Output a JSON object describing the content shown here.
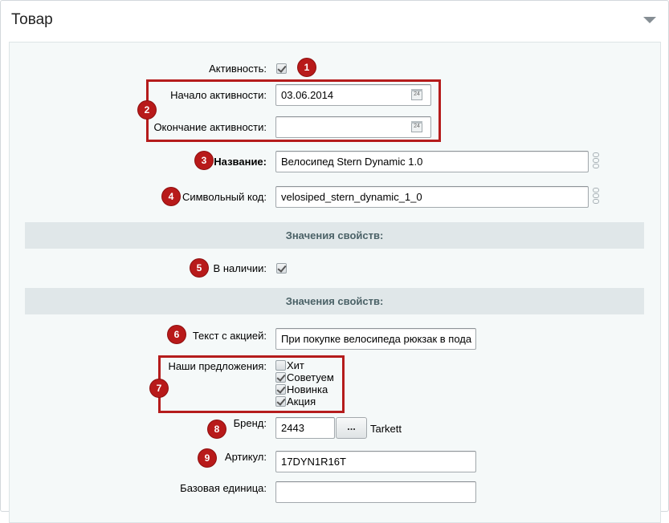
{
  "panel": {
    "title": "Товар",
    "collapse_icon": "chevron-down-icon"
  },
  "fields": {
    "active": {
      "label": "Активность:",
      "checked": true
    },
    "active_from": {
      "label": "Начало активности:",
      "value": "03.06.2014",
      "icon": "calendar-icon",
      "icon_text": "24"
    },
    "active_to": {
      "label": "Окончание активности:",
      "value": "",
      "icon": "calendar-icon",
      "icon_text": "24"
    },
    "name": {
      "label": "Название:",
      "value": "Велосипед Stern Dynamic 1.0",
      "icon": "link-icon"
    },
    "code": {
      "label": "Символьный код:",
      "value": "velosiped_stern_dynamic_1_0",
      "icon": "link-icon"
    },
    "in_stock": {
      "label": "В наличии:",
      "checked": true
    },
    "promo_text": {
      "label": "Текст с акцией:",
      "value": "При покупке велосипеда рюкзак в пода"
    },
    "offers": {
      "label": "Наши предложения:",
      "options": [
        {
          "label": "Хит",
          "checked": false
        },
        {
          "label": "Советуем",
          "checked": true
        },
        {
          "label": "Новинка",
          "checked": true
        },
        {
          "label": "Акция",
          "checked": true
        }
      ]
    },
    "brand": {
      "label": "Бренд:",
      "value": "2443",
      "button": "...",
      "brand_name": "Tarkett"
    },
    "article": {
      "label": "Артикул:",
      "value": "17DYN1R16T"
    },
    "base_unit": {
      "label": "Базовая единица:",
      "value": ""
    }
  },
  "sections": {
    "props1": "Значения свойств:",
    "props2": "Значения свойств:"
  },
  "badges": [
    "1",
    "2",
    "3",
    "4",
    "5",
    "6",
    "7",
    "8",
    "9"
  ],
  "colors": {
    "badge": "#b81a1a",
    "highlight_box": "#b51c1c",
    "section_bg": "#e0e7e9",
    "content_bg": "#f5f9f9"
  }
}
